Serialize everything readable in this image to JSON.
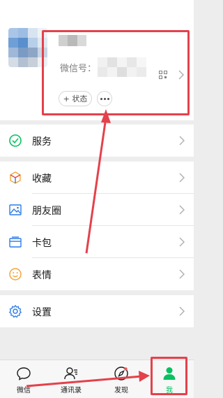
{
  "profile": {
    "wechat_id_label": "微信号：",
    "status_button_label": "+ 状态",
    "more_icon": "ellipsis-icon",
    "qr_icon": "qr-code-icon"
  },
  "menu": {
    "groups": [
      [
        {
          "label": "服务",
          "icon": "wechat-pay-icon"
        }
      ],
      [
        {
          "label": "收藏",
          "icon": "favorites-cube-icon"
        },
        {
          "label": "朋友圈",
          "icon": "moments-image-icon"
        },
        {
          "label": "卡包",
          "icon": "card-wallet-icon"
        },
        {
          "label": "表情",
          "icon": "emoji-face-icon"
        }
      ],
      [
        {
          "label": "设置",
          "icon": "settings-gear-icon"
        }
      ]
    ]
  },
  "tabbar": {
    "tabs": [
      {
        "label": "微信",
        "icon": "chat-bubble-icon",
        "active": false
      },
      {
        "label": "通讯录",
        "icon": "contacts-icon",
        "active": false
      },
      {
        "label": "发现",
        "icon": "compass-icon",
        "active": false
      },
      {
        "label": "我",
        "icon": "person-icon",
        "active": true
      }
    ]
  },
  "colors": {
    "accent": "#07c160",
    "annotation": "#e4414b",
    "background": "#ededed"
  }
}
